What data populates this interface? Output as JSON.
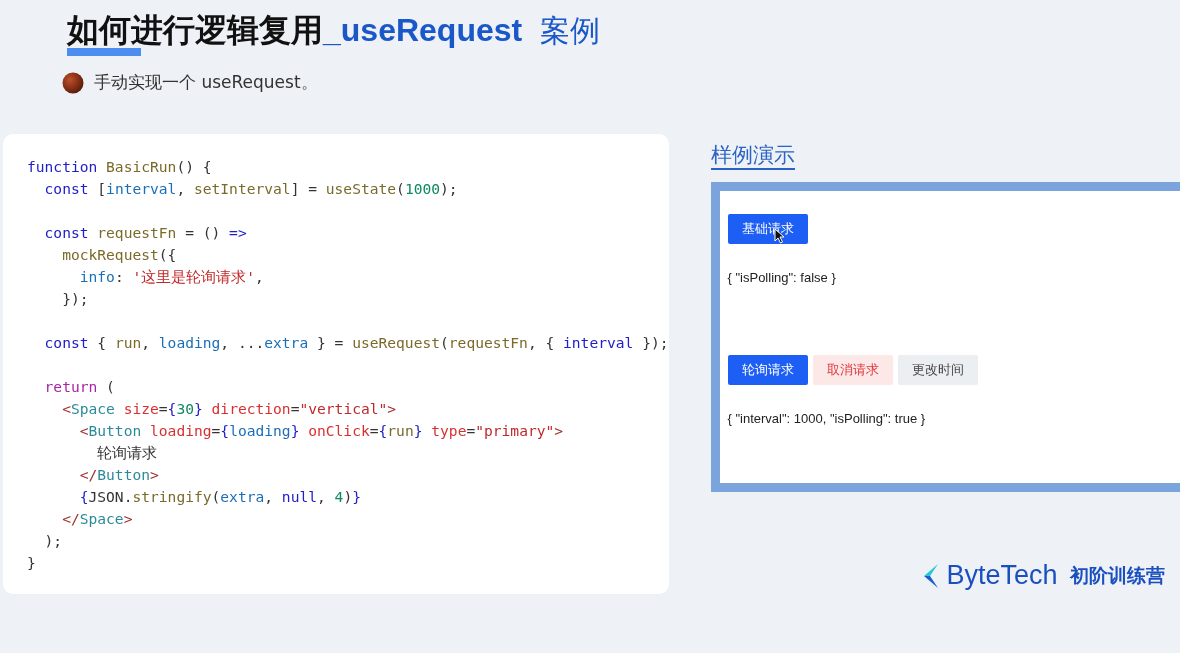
{
  "title": {
    "parts": [
      {
        "text": "如何进行逻辑复用",
        "kind": "main"
      },
      {
        "text": "_useRequest",
        "kind": "code"
      },
      {
        "text": "案例",
        "kind": "aside"
      }
    ]
  },
  "bullet": "手动实现一个 useRequest。",
  "code": {
    "blocks": [
      [
        [
          {
            "text": "function",
            "kind": "kw"
          },
          {
            "text": " BasicRun",
            "kind": "fn"
          },
          {
            "text": "() {",
            "kind": "plain"
          }
        ],
        [
          {
            "text": "  const",
            "kind": "kw"
          },
          {
            "text": " [",
            "kind": "plain"
          },
          {
            "text": "interval",
            "kind": "var"
          },
          {
            "text": ", ",
            "kind": "plain"
          },
          {
            "text": "setInterval",
            "kind": "fn"
          },
          {
            "text": "] = ",
            "kind": "plain"
          },
          {
            "text": "useState",
            "kind": "fn"
          },
          {
            "text": "(",
            "kind": "plain"
          },
          {
            "text": "1000",
            "kind": "num"
          },
          {
            "text": ");",
            "kind": "plain"
          }
        ]
      ],
      [
        [
          {
            "text": "  const",
            "kind": "kw"
          },
          {
            "text": " requestFn",
            "kind": "fn"
          },
          {
            "text": " = () ",
            "kind": "plain"
          },
          {
            "text": "=>",
            "kind": "kw"
          }
        ],
        [
          {
            "text": "    mockRequest",
            "kind": "fn"
          },
          {
            "text": "({",
            "kind": "plain"
          }
        ],
        [
          {
            "text": "      info",
            "kind": "var"
          },
          {
            "text": ": ",
            "kind": "plain"
          },
          {
            "text": "'这里是轮询请求'",
            "kind": "str"
          },
          {
            "text": ",",
            "kind": "plain"
          }
        ],
        [
          {
            "text": "    });",
            "kind": "plain"
          }
        ]
      ],
      [
        [
          {
            "text": "  const",
            "kind": "kw"
          },
          {
            "text": " { ",
            "kind": "plain"
          },
          {
            "text": "run",
            "kind": "fn"
          },
          {
            "text": ", ",
            "kind": "plain"
          },
          {
            "text": "loading",
            "kind": "var"
          },
          {
            "text": ", ...",
            "kind": "plain"
          },
          {
            "text": "extra",
            "kind": "var"
          },
          {
            "text": " } = ",
            "kind": "plain"
          },
          {
            "text": "useRequest",
            "kind": "fn"
          },
          {
            "text": "(",
            "kind": "plain"
          },
          {
            "text": "requestFn",
            "kind": "fn"
          },
          {
            "text": ", { ",
            "kind": "plain"
          },
          {
            "text": "interval",
            "kind": "kw"
          },
          {
            "text": " });",
            "kind": "plain"
          }
        ]
      ],
      [
        [
          {
            "text": "  return",
            "kind": "ret"
          },
          {
            "text": " (",
            "kind": "plain"
          }
        ],
        [
          {
            "text": "    <",
            "kind": "punct"
          },
          {
            "text": "Space",
            "kind": "tag"
          },
          {
            "text": " size",
            "kind": "attr"
          },
          {
            "text": "=",
            "kind": "plain"
          },
          {
            "text": "{",
            "kind": "kw"
          },
          {
            "text": "30",
            "kind": "num"
          },
          {
            "text": "}",
            "kind": "kw"
          },
          {
            "text": " direction",
            "kind": "attr"
          },
          {
            "text": "=",
            "kind": "plain"
          },
          {
            "text": "\"vertical\"",
            "kind": "str"
          },
          {
            "text": ">",
            "kind": "punct"
          }
        ],
        [
          {
            "text": "      <",
            "kind": "punct"
          },
          {
            "text": "Button",
            "kind": "tag"
          },
          {
            "text": " loading",
            "kind": "attr"
          },
          {
            "text": "=",
            "kind": "plain"
          },
          {
            "text": "{",
            "kind": "kw"
          },
          {
            "text": "loading",
            "kind": "var"
          },
          {
            "text": "}",
            "kind": "kw"
          },
          {
            "text": " onClick",
            "kind": "attr"
          },
          {
            "text": "=",
            "kind": "plain"
          },
          {
            "text": "{",
            "kind": "kw"
          },
          {
            "text": "run",
            "kind": "fn"
          },
          {
            "text": "}",
            "kind": "kw"
          },
          {
            "text": " type",
            "kind": "attr"
          },
          {
            "text": "=",
            "kind": "plain"
          },
          {
            "text": "\"primary\"",
            "kind": "str"
          },
          {
            "text": ">",
            "kind": "punct"
          }
        ],
        [
          {
            "text": "        轮询请求",
            "kind": "plain"
          }
        ],
        [
          {
            "text": "      </",
            "kind": "punct"
          },
          {
            "text": "Button",
            "kind": "tag"
          },
          {
            "text": ">",
            "kind": "punct"
          }
        ],
        [
          {
            "text": "      {",
            "kind": "kw"
          },
          {
            "text": "JSON.",
            "kind": "plain"
          },
          {
            "text": "stringify",
            "kind": "fn"
          },
          {
            "text": "(",
            "kind": "plain"
          },
          {
            "text": "extra",
            "kind": "var"
          },
          {
            "text": ", ",
            "kind": "plain"
          },
          {
            "text": "null",
            "kind": "kw"
          },
          {
            "text": ", ",
            "kind": "plain"
          },
          {
            "text": "4",
            "kind": "num"
          },
          {
            "text": ")",
            "kind": "plain"
          },
          {
            "text": "}",
            "kind": "kw"
          }
        ],
        [
          {
            "text": "    </",
            "kind": "punct"
          },
          {
            "text": "Space",
            "kind": "tag"
          },
          {
            "text": ">",
            "kind": "punct"
          }
        ],
        [
          {
            "text": "  );",
            "kind": "plain"
          }
        ],
        [
          {
            "text": "}",
            "kind": "plain"
          }
        ]
      ]
    ]
  },
  "demo": {
    "heading": "样例演示",
    "sections": [
      {
        "buttons": [
          {
            "label": "基础请求",
            "kind": "primary",
            "hovered": true
          }
        ],
        "output": "{ \"isPolling\": false }"
      },
      {
        "buttons": [
          {
            "label": "轮询请求",
            "kind": "primary",
            "hovered": false
          },
          {
            "label": "取消请求",
            "kind": "danger",
            "hovered": false
          },
          {
            "label": "更改时间",
            "kind": "default",
            "hovered": false
          }
        ],
        "output": "{ \"interval\": 1000, \"isPolling\": true }"
      }
    ]
  },
  "brand": {
    "name": "ByteTech",
    "program": "初阶训练营"
  }
}
